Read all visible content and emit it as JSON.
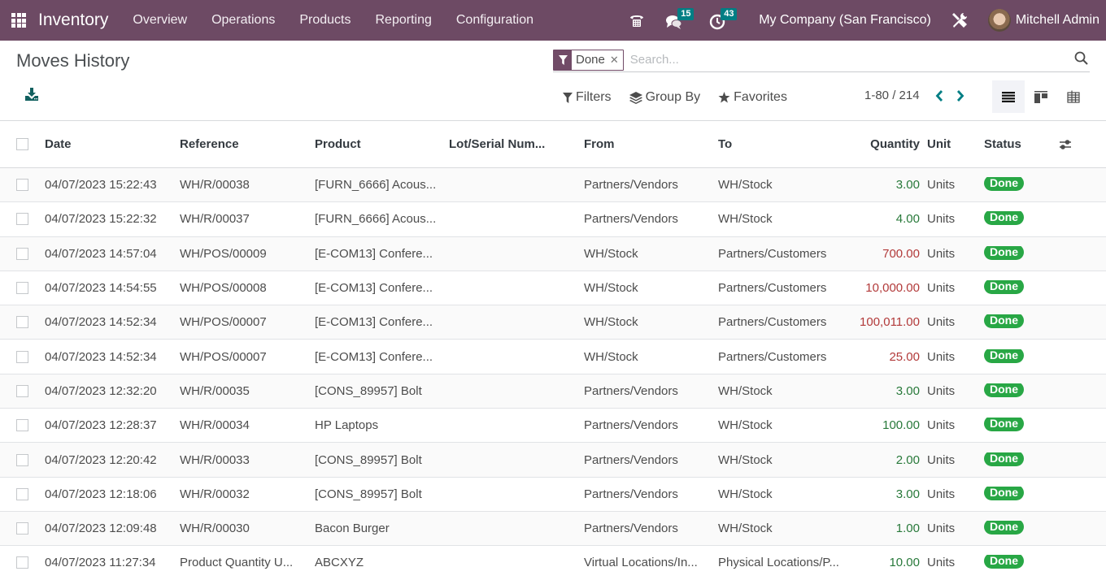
{
  "navbar": {
    "brand": "Inventory",
    "menu": [
      "Overview",
      "Operations",
      "Products",
      "Reporting",
      "Configuration"
    ],
    "messages_badge": "15",
    "activities_badge": "43",
    "company": "My Company (San Francisco)",
    "user_name": "Mitchell Admin",
    "brand_color": "#714b67"
  },
  "control_panel": {
    "title": "Moves History",
    "search": {
      "facet_value": "Done",
      "placeholder": "Search..."
    },
    "filters_label": "Filters",
    "group_by_label": "Group By",
    "favorites_label": "Favorites",
    "pager": "1-80 / 214"
  },
  "table": {
    "headers": {
      "date": "Date",
      "reference": "Reference",
      "product": "Product",
      "lot": "Lot/Serial Num...",
      "from": "From",
      "to": "To",
      "quantity": "Quantity",
      "unit": "Unit",
      "status": "Status"
    },
    "rows": [
      {
        "date": "04/07/2023 15:22:43",
        "reference": "WH/R/00038",
        "product": "[FURN_6666] Acous...",
        "lot": "",
        "from": "Partners/Vendors",
        "to": "WH/Stock",
        "quantity": "3.00",
        "qty_sign": "pos",
        "unit": "Units",
        "status": "Done"
      },
      {
        "date": "04/07/2023 15:22:32",
        "reference": "WH/R/00037",
        "product": "[FURN_6666] Acous...",
        "lot": "",
        "from": "Partners/Vendors",
        "to": "WH/Stock",
        "quantity": "4.00",
        "qty_sign": "pos",
        "unit": "Units",
        "status": "Done"
      },
      {
        "date": "04/07/2023 14:57:04",
        "reference": "WH/POS/00009",
        "product": "[E-COM13] Confere...",
        "lot": "",
        "from": "WH/Stock",
        "to": "Partners/Customers",
        "quantity": "700.00",
        "qty_sign": "neg",
        "unit": "Units",
        "status": "Done"
      },
      {
        "date": "04/07/2023 14:54:55",
        "reference": "WH/POS/00008",
        "product": "[E-COM13] Confere...",
        "lot": "",
        "from": "WH/Stock",
        "to": "Partners/Customers",
        "quantity": "10,000.00",
        "qty_sign": "neg",
        "unit": "Units",
        "status": "Done"
      },
      {
        "date": "04/07/2023 14:52:34",
        "reference": "WH/POS/00007",
        "product": "[E-COM13] Confere...",
        "lot": "",
        "from": "WH/Stock",
        "to": "Partners/Customers",
        "quantity": "100,011.00",
        "qty_sign": "neg",
        "unit": "Units",
        "status": "Done"
      },
      {
        "date": "04/07/2023 14:52:34",
        "reference": "WH/POS/00007",
        "product": "[E-COM13] Confere...",
        "lot": "",
        "from": "WH/Stock",
        "to": "Partners/Customers",
        "quantity": "25.00",
        "qty_sign": "neg",
        "unit": "Units",
        "status": "Done"
      },
      {
        "date": "04/07/2023 12:32:20",
        "reference": "WH/R/00035",
        "product": "[CONS_89957] Bolt",
        "lot": "",
        "from": "Partners/Vendors",
        "to": "WH/Stock",
        "quantity": "3.00",
        "qty_sign": "pos",
        "unit": "Units",
        "status": "Done"
      },
      {
        "date": "04/07/2023 12:28:37",
        "reference": "WH/R/00034",
        "product": "HP Laptops",
        "lot": "",
        "from": "Partners/Vendors",
        "to": "WH/Stock",
        "quantity": "100.00",
        "qty_sign": "pos",
        "unit": "Units",
        "status": "Done"
      },
      {
        "date": "04/07/2023 12:20:42",
        "reference": "WH/R/00033",
        "product": "[CONS_89957] Bolt",
        "lot": "",
        "from": "Partners/Vendors",
        "to": "WH/Stock",
        "quantity": "2.00",
        "qty_sign": "pos",
        "unit": "Units",
        "status": "Done"
      },
      {
        "date": "04/07/2023 12:18:06",
        "reference": "WH/R/00032",
        "product": "[CONS_89957] Bolt",
        "lot": "",
        "from": "Partners/Vendors",
        "to": "WH/Stock",
        "quantity": "3.00",
        "qty_sign": "pos",
        "unit": "Units",
        "status": "Done"
      },
      {
        "date": "04/07/2023 12:09:48",
        "reference": "WH/R/00030",
        "product": "Bacon Burger",
        "lot": "",
        "from": "Partners/Vendors",
        "to": "WH/Stock",
        "quantity": "1.00",
        "qty_sign": "pos",
        "unit": "Units",
        "status": "Done"
      },
      {
        "date": "04/07/2023 11:27:34",
        "reference": "Product Quantity U...",
        "product": "ABCXYZ",
        "lot": "",
        "from": "Virtual Locations/In...",
        "to": "Physical Locations/P...",
        "quantity": "10.00",
        "qty_sign": "pos",
        "unit": "Units",
        "status": "Done"
      }
    ],
    "colors": {
      "qty_positive": "#28793a",
      "qty_negative": "#b23a3a",
      "status_done": "#28a745"
    }
  }
}
